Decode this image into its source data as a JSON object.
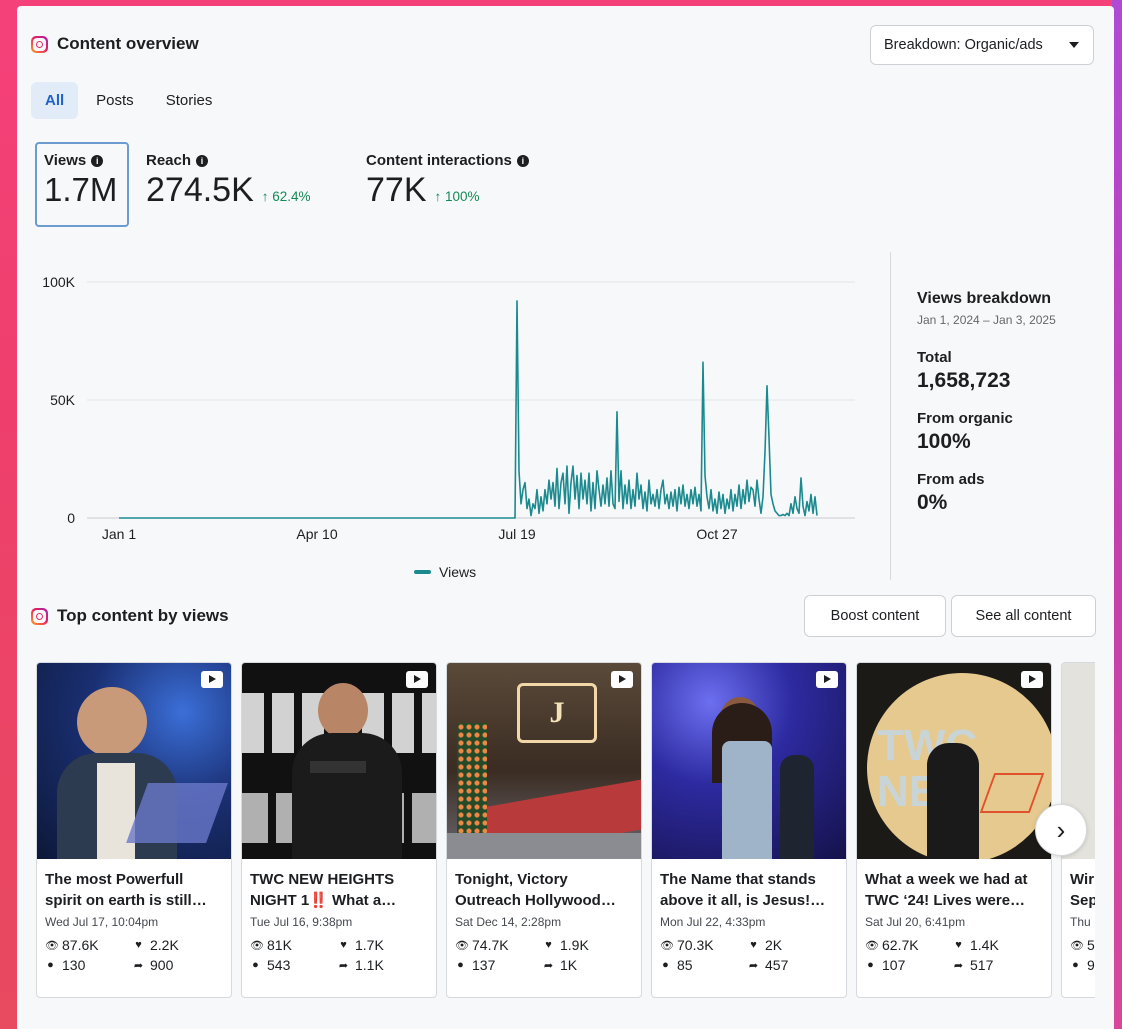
{
  "overview": {
    "title": "Content overview",
    "breakdown_label": "Breakdown: Organic/ads",
    "tabs": [
      {
        "label": "All",
        "active": true
      },
      {
        "label": "Posts",
        "active": false
      },
      {
        "label": "Stories",
        "active": false
      }
    ],
    "metrics": {
      "views": {
        "label": "Views",
        "value": "1.7M",
        "selected": true
      },
      "reach": {
        "label": "Reach",
        "value": "274.5K",
        "delta": "↑ 62.4%"
      },
      "interactions": {
        "label": "Content interactions",
        "value": "77K",
        "delta": "↑ 100%"
      }
    }
  },
  "chart_data": {
    "type": "line",
    "series": [
      {
        "name": "Views",
        "color": "#1a8a8f",
        "points": [
          [
            0,
            0
          ],
          [
            14,
            0
          ],
          [
            28,
            0
          ],
          [
            42,
            0
          ],
          [
            56,
            0
          ],
          [
            70,
            0
          ],
          [
            84,
            0
          ],
          [
            98,
            0
          ],
          [
            112,
            0
          ],
          [
            126,
            0
          ],
          [
            140,
            0
          ],
          [
            154,
            0
          ],
          [
            168,
            0
          ],
          [
            182,
            0
          ],
          [
            196,
            0
          ],
          [
            198,
            0
          ],
          [
            199,
            92000
          ],
          [
            200,
            20000
          ],
          [
            201,
            6000
          ],
          [
            202,
            12000
          ],
          [
            203,
            15000
          ],
          [
            204,
            4000
          ],
          [
            205,
            8000
          ],
          [
            206,
            1000
          ],
          [
            207,
            6000
          ],
          [
            208,
            4000
          ],
          [
            209,
            12000
          ],
          [
            210,
            2000
          ],
          [
            211,
            9000
          ],
          [
            212,
            3000
          ],
          [
            213,
            12000
          ],
          [
            214,
            6000
          ],
          [
            215,
            16000
          ],
          [
            216,
            8000
          ],
          [
            217,
            15000
          ],
          [
            218,
            5000
          ],
          [
            219,
            21000
          ],
          [
            220,
            4000
          ],
          [
            221,
            15000
          ],
          [
            222,
            19000
          ],
          [
            223,
            6000
          ],
          [
            224,
            22000
          ],
          [
            225,
            2000
          ],
          [
            226,
            15000
          ],
          [
            227,
            22000
          ],
          [
            228,
            8000
          ],
          [
            229,
            18000
          ],
          [
            230,
            4000
          ],
          [
            231,
            19000
          ],
          [
            232,
            8000
          ],
          [
            233,
            16000
          ],
          [
            234,
            6000
          ],
          [
            235,
            19000
          ],
          [
            236,
            3000
          ],
          [
            237,
            15000
          ],
          [
            238,
            4000
          ],
          [
            239,
            20000
          ],
          [
            240,
            12000
          ],
          [
            241,
            5000
          ],
          [
            242,
            14000
          ],
          [
            243,
            6000
          ],
          [
            244,
            17000
          ],
          [
            245,
            5000
          ],
          [
            246,
            20000
          ],
          [
            247,
            6000
          ],
          [
            248,
            4000
          ],
          [
            249,
            45000
          ],
          [
            250,
            7000
          ],
          [
            251,
            20000
          ],
          [
            252,
            4000
          ],
          [
            253,
            14000
          ],
          [
            254,
            6000
          ],
          [
            255,
            16000
          ],
          [
            256,
            4000
          ],
          [
            257,
            12000
          ],
          [
            258,
            5000
          ],
          [
            259,
            19000
          ],
          [
            260,
            8000
          ],
          [
            261,
            14000
          ],
          [
            262,
            4000
          ],
          [
            263,
            11000
          ],
          [
            264,
            3000
          ],
          [
            265,
            16000
          ],
          [
            266,
            6000
          ],
          [
            267,
            10000
          ],
          [
            268,
            5000
          ],
          [
            269,
            12000
          ],
          [
            270,
            4000
          ],
          [
            271,
            12000
          ],
          [
            272,
            16000
          ],
          [
            273,
            6000
          ],
          [
            274,
            10000
          ],
          [
            275,
            4000
          ],
          [
            276,
            11000
          ],
          [
            277,
            5000
          ],
          [
            278,
            12000
          ],
          [
            279,
            3000
          ],
          [
            280,
            13000
          ],
          [
            281,
            6000
          ],
          [
            282,
            14000
          ],
          [
            283,
            5000
          ],
          [
            284,
            10000
          ],
          [
            285,
            4000
          ],
          [
            286,
            12000
          ],
          [
            287,
            6000
          ],
          [
            288,
            13000
          ],
          [
            289,
            5000
          ],
          [
            290,
            10000
          ],
          [
            291,
            3000
          ],
          [
            292,
            66000
          ],
          [
            293,
            18000
          ],
          [
            294,
            9000
          ],
          [
            295,
            4000
          ],
          [
            296,
            12000
          ],
          [
            297,
            3000
          ],
          [
            298,
            8000
          ],
          [
            299,
            2000
          ],
          [
            300,
            11000
          ],
          [
            301,
            4000
          ],
          [
            302,
            10000
          ],
          [
            303,
            2000
          ],
          [
            304,
            8000
          ],
          [
            305,
            4000
          ],
          [
            306,
            12000
          ],
          [
            307,
            3000
          ],
          [
            308,
            10000
          ],
          [
            309,
            5000
          ],
          [
            310,
            14000
          ],
          [
            311,
            4000
          ],
          [
            312,
            12000
          ],
          [
            313,
            6000
          ],
          [
            314,
            16000
          ],
          [
            315,
            7000
          ],
          [
            316,
            13000
          ],
          [
            317,
            12000
          ],
          [
            318,
            5000
          ],
          [
            319,
            16000
          ],
          [
            320,
            8000
          ],
          [
            321,
            2000
          ],
          [
            322,
            9000
          ],
          [
            323,
            28000
          ],
          [
            324,
            56000
          ],
          [
            325,
            34000
          ],
          [
            326,
            10000
          ],
          [
            327,
            6000
          ],
          [
            328,
            3000
          ],
          [
            329,
            2000
          ],
          [
            330,
            1000
          ],
          [
            331,
            1000
          ],
          [
            332,
            1500
          ],
          [
            333,
            1000
          ],
          [
            334,
            2000
          ],
          [
            335,
            1000
          ],
          [
            336,
            6000
          ],
          [
            337,
            2000
          ],
          [
            338,
            9000
          ],
          [
            339,
            4000
          ],
          [
            340,
            2000
          ],
          [
            341,
            17000
          ],
          [
            342,
            5000
          ],
          [
            343,
            1000
          ],
          [
            344,
            7000
          ],
          [
            345,
            3000
          ],
          [
            346,
            10000
          ],
          [
            347,
            2000
          ],
          [
            348,
            9000
          ],
          [
            349,
            1000
          ]
        ]
      }
    ],
    "x_ticks": [
      {
        "x": 0,
        "label": "Jan 1"
      },
      {
        "x": 99,
        "label": "Apr 10"
      },
      {
        "x": 199,
        "label": "Jul 19"
      },
      {
        "x": 299,
        "label": "Oct 27"
      }
    ],
    "y_ticks": [
      {
        "y": 0,
        "label": "0"
      },
      {
        "y": 50000,
        "label": "50K"
      },
      {
        "y": 100000,
        "label": "100K"
      }
    ],
    "xlim": [
      0,
      368
    ],
    "ylim": [
      0,
      100000
    ],
    "grid": true,
    "legend": "bottom"
  },
  "breakdown": {
    "title": "Views breakdown",
    "date_range": "Jan 1, 2024 – Jan 3, 2025",
    "total_label": "Total",
    "total_value": "1,658,723",
    "organic_label": "From organic",
    "organic_value": "100%",
    "ads_label": "From ads",
    "ads_value": "0%"
  },
  "top_content": {
    "title": "Top content by views",
    "boost_label": "Boost content",
    "see_all_label": "See all content",
    "cards": [
      {
        "title1": "The most Powerfull",
        "title2": "spirit on earth is still…",
        "date": "Wed Jul 17, 10:04pm",
        "views": "87.6K",
        "likes": "2.2K",
        "comments": "130",
        "shares": "900"
      },
      {
        "title1": "TWC NEW HEIGHTS",
        "title2": "NIGHT 1‼️ What a…",
        "date": "Tue Jul 16, 9:38pm",
        "views": "81K",
        "likes": "1.7K",
        "comments": "543",
        "shares": "1.1K"
      },
      {
        "title1": "Tonight, Victory",
        "title2": "Outreach Hollywood…",
        "date": "Sat Dec 14, 2:28pm",
        "views": "74.7K",
        "likes": "1.9K",
        "comments": "137",
        "shares": "1K"
      },
      {
        "title1": "The Name that stands",
        "title2": "above it all, is Jesus!…",
        "date": "Mon Jul 22, 4:33pm",
        "views": "70.3K",
        "likes": "2K",
        "comments": "85",
        "shares": "457"
      },
      {
        "title1": "What a week we had at",
        "title2": "TWC ‘24! Lives were…",
        "date": "Sat Jul 20, 6:41pm",
        "views": "62.7K",
        "likes": "1.4K",
        "comments": "107",
        "shares": "517"
      },
      {
        "title1": "Wir",
        "title2": "Sep",
        "date": "Thu",
        "views": "5",
        "likes": "",
        "comments": "9",
        "shares": ""
      }
    ]
  }
}
